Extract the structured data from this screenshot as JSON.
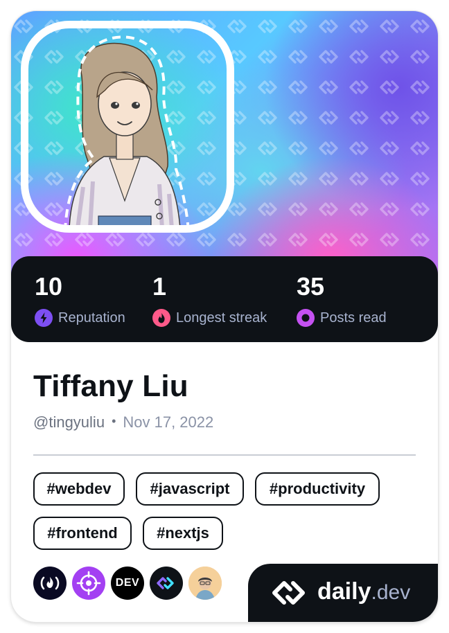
{
  "profile": {
    "name": "Tiffany Liu",
    "username": "@tingyuliu",
    "separator": "•",
    "joined": "Nov 17, 2022",
    "avatar_icon": "illustrated-portrait"
  },
  "stats": [
    {
      "value": "10",
      "label": "Reputation",
      "icon": "bolt-icon",
      "color": "#7d4ff3"
    },
    {
      "value": "1",
      "label": "Longest streak",
      "icon": "flame-icon",
      "color": "#ff5a8a"
    },
    {
      "value": "35",
      "label": "Posts read",
      "icon": "eye-ring-icon",
      "color": "#c451f1"
    }
  ],
  "tags": [
    "#webdev",
    "#javascript",
    "#productivity",
    "#frontend",
    "#nextjs"
  ],
  "sources": [
    {
      "name": "freecodecamp-icon",
      "text": "(🔥)"
    },
    {
      "name": "crosshair-icon",
      "text": ""
    },
    {
      "name": "dev-to-icon",
      "text": "DEV"
    },
    {
      "name": "daily-dev-squad-icon",
      "text": ""
    },
    {
      "name": "person-avatar-icon",
      "text": ""
    }
  ],
  "brand": {
    "name": "daily",
    "tld": ".dev"
  },
  "colors": {
    "dark": "#0e1217",
    "label": "#a8b3cf",
    "accent_purple": "#7d4ff3",
    "accent_pink": "#ff5a8a",
    "accent_magenta": "#c451f1"
  }
}
